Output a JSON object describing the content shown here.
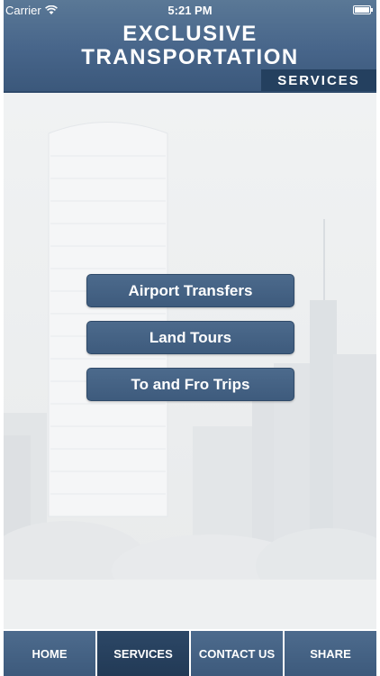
{
  "status_bar": {
    "carrier": "Carrier",
    "time": "5:21 PM",
    "wifi_icon": "wifi-icon",
    "battery_icon": "battery-icon"
  },
  "header": {
    "title_line1": "EXCLUSIVE",
    "title_line2": "TRANSPORTATION",
    "section_tag": "SERVICES"
  },
  "menu": {
    "items": [
      {
        "label": "Airport Transfers"
      },
      {
        "label": "Land Tours"
      },
      {
        "label": "To and Fro Trips"
      }
    ]
  },
  "tabbar": {
    "active_index": 1,
    "tabs": [
      {
        "label": "HOME"
      },
      {
        "label": "SERVICES"
      },
      {
        "label": "CONTACT US"
      },
      {
        "label": "SHARE"
      }
    ]
  },
  "colors": {
    "header": "#47658a",
    "button": "#3e5b7d",
    "tab_active": "#2c4766",
    "background": "#eceeef"
  }
}
